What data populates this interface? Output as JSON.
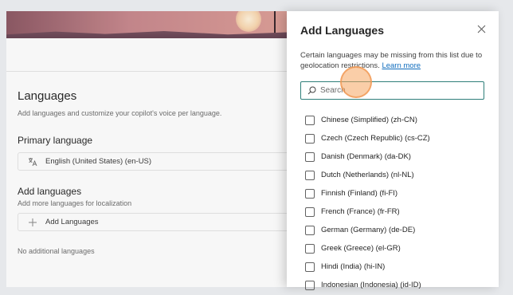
{
  "page": {
    "title": "Languages",
    "description": "Add languages and customize your copilot's voice per language.",
    "primary_language": {
      "label": "Primary language",
      "value": "English (United States) (en-US)"
    },
    "add_languages": {
      "label": "Add languages",
      "description": "Add more languages for localization",
      "button_label": "Add Languages"
    },
    "empty_state": "No additional languages"
  },
  "panel": {
    "title": "Add Languages",
    "description": "Certain languages may be missing from this list due to geolocation restrictions.",
    "learn_more": "Learn more",
    "search_placeholder": "Search",
    "languages": [
      "Chinese (Simplified) (zh-CN)",
      "Czech (Czech Republic) (cs-CZ)",
      "Danish (Denmark) (da-DK)",
      "Dutch (Netherlands) (nl-NL)",
      "Finnish (Finland) (fi-FI)",
      "French (France) (fr-FR)",
      "German (Germany) (de-DE)",
      "Greek (Greece) (el-GR)",
      "Hindi (India) (hi-IN)",
      "Indonesian (Indonesia) (id-ID)"
    ]
  },
  "colors": {
    "accent": "#0f6cbd",
    "focus_border": "#2f7f7a",
    "cursor_highlight": "#f5a660"
  },
  "icons": {
    "close": "close-icon",
    "search": "search-icon",
    "translate": "translate-icon",
    "add": "plus-icon"
  }
}
